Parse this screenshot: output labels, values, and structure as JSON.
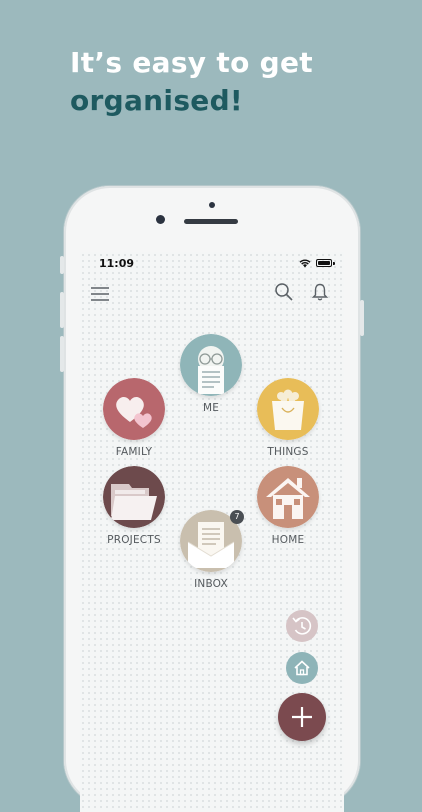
{
  "headline": {
    "line1": "It’s easy to get",
    "line2": "organised!"
  },
  "status_bar": {
    "time": "11:09",
    "icons": [
      "wifi-icon",
      "battery-icon"
    ]
  },
  "toolbar": {
    "icons": [
      "menu-icon",
      "search-icon",
      "bell-icon"
    ]
  },
  "categories": [
    {
      "label": "ME",
      "icon": "reading-person-icon",
      "color": "#8fb5b8"
    },
    {
      "label": "FAMILY",
      "icon": "hearts-icon",
      "color": "#b8676d"
    },
    {
      "label": "THINGS",
      "icon": "shopping-bag-icon",
      "color": "#e8bd58"
    },
    {
      "label": "PROJECTS",
      "icon": "folder-icon",
      "color": "#6d4a4c"
    },
    {
      "label": "HOME",
      "icon": "house-icon",
      "color": "#c8907a"
    },
    {
      "label": "INBOX",
      "icon": "envelope-icon",
      "color": "#c9bfae",
      "badge": "7"
    }
  ],
  "fab": {
    "icons": [
      "history-icon",
      "home-icon",
      "plus-icon"
    ],
    "colors": {
      "history": "#d6c4c6",
      "home": "#8eb4b8",
      "add": "#7b4a4f"
    }
  },
  "colors": {
    "background": "#9cb9bd",
    "headline_light": "#ffffff",
    "headline_dark": "#1e5a60"
  }
}
